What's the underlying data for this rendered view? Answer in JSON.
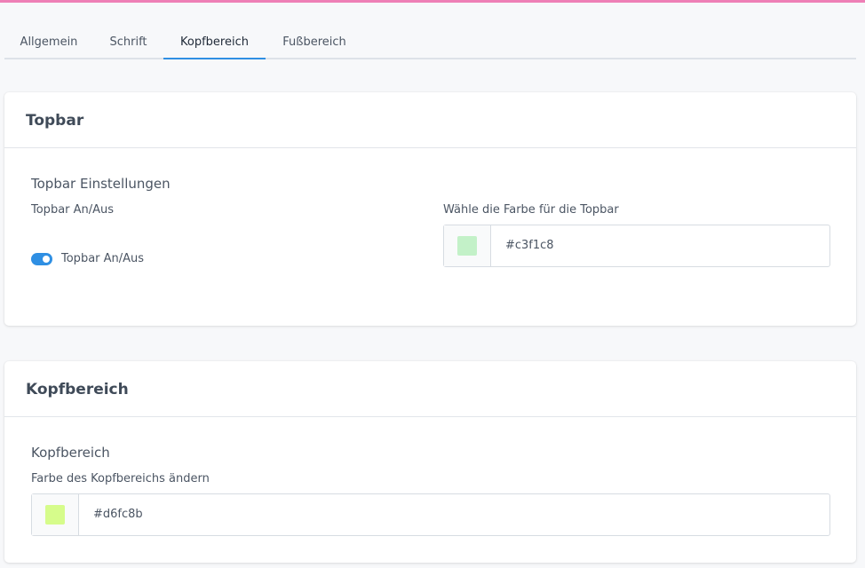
{
  "tabs": [
    {
      "label": "Allgemein",
      "active": false
    },
    {
      "label": "Schrift",
      "active": false
    },
    {
      "label": "Kopfbereich",
      "active": true
    },
    {
      "label": "Fußbereich",
      "active": false
    }
  ],
  "topbar_card": {
    "title": "Topbar",
    "section_title": "Topbar Einstellungen",
    "toggle_field_label": "Topbar An/Aus",
    "toggle_label": "Topbar An/Aus",
    "toggle_on": true,
    "color_field_label": "Wähle die Farbe für die Topbar",
    "color_value": "#c3f1c8"
  },
  "header_card": {
    "title": "Kopfbereich",
    "section_title": "Kopfbereich",
    "color_field_label": "Farbe des Kopfbereichs ändern",
    "color_value": "#d6fc8b"
  },
  "colors": {
    "accent_top_line": "#ee7fb6",
    "active_tab": "#2f8fe3",
    "toggle_on": "#2f8fe3"
  }
}
